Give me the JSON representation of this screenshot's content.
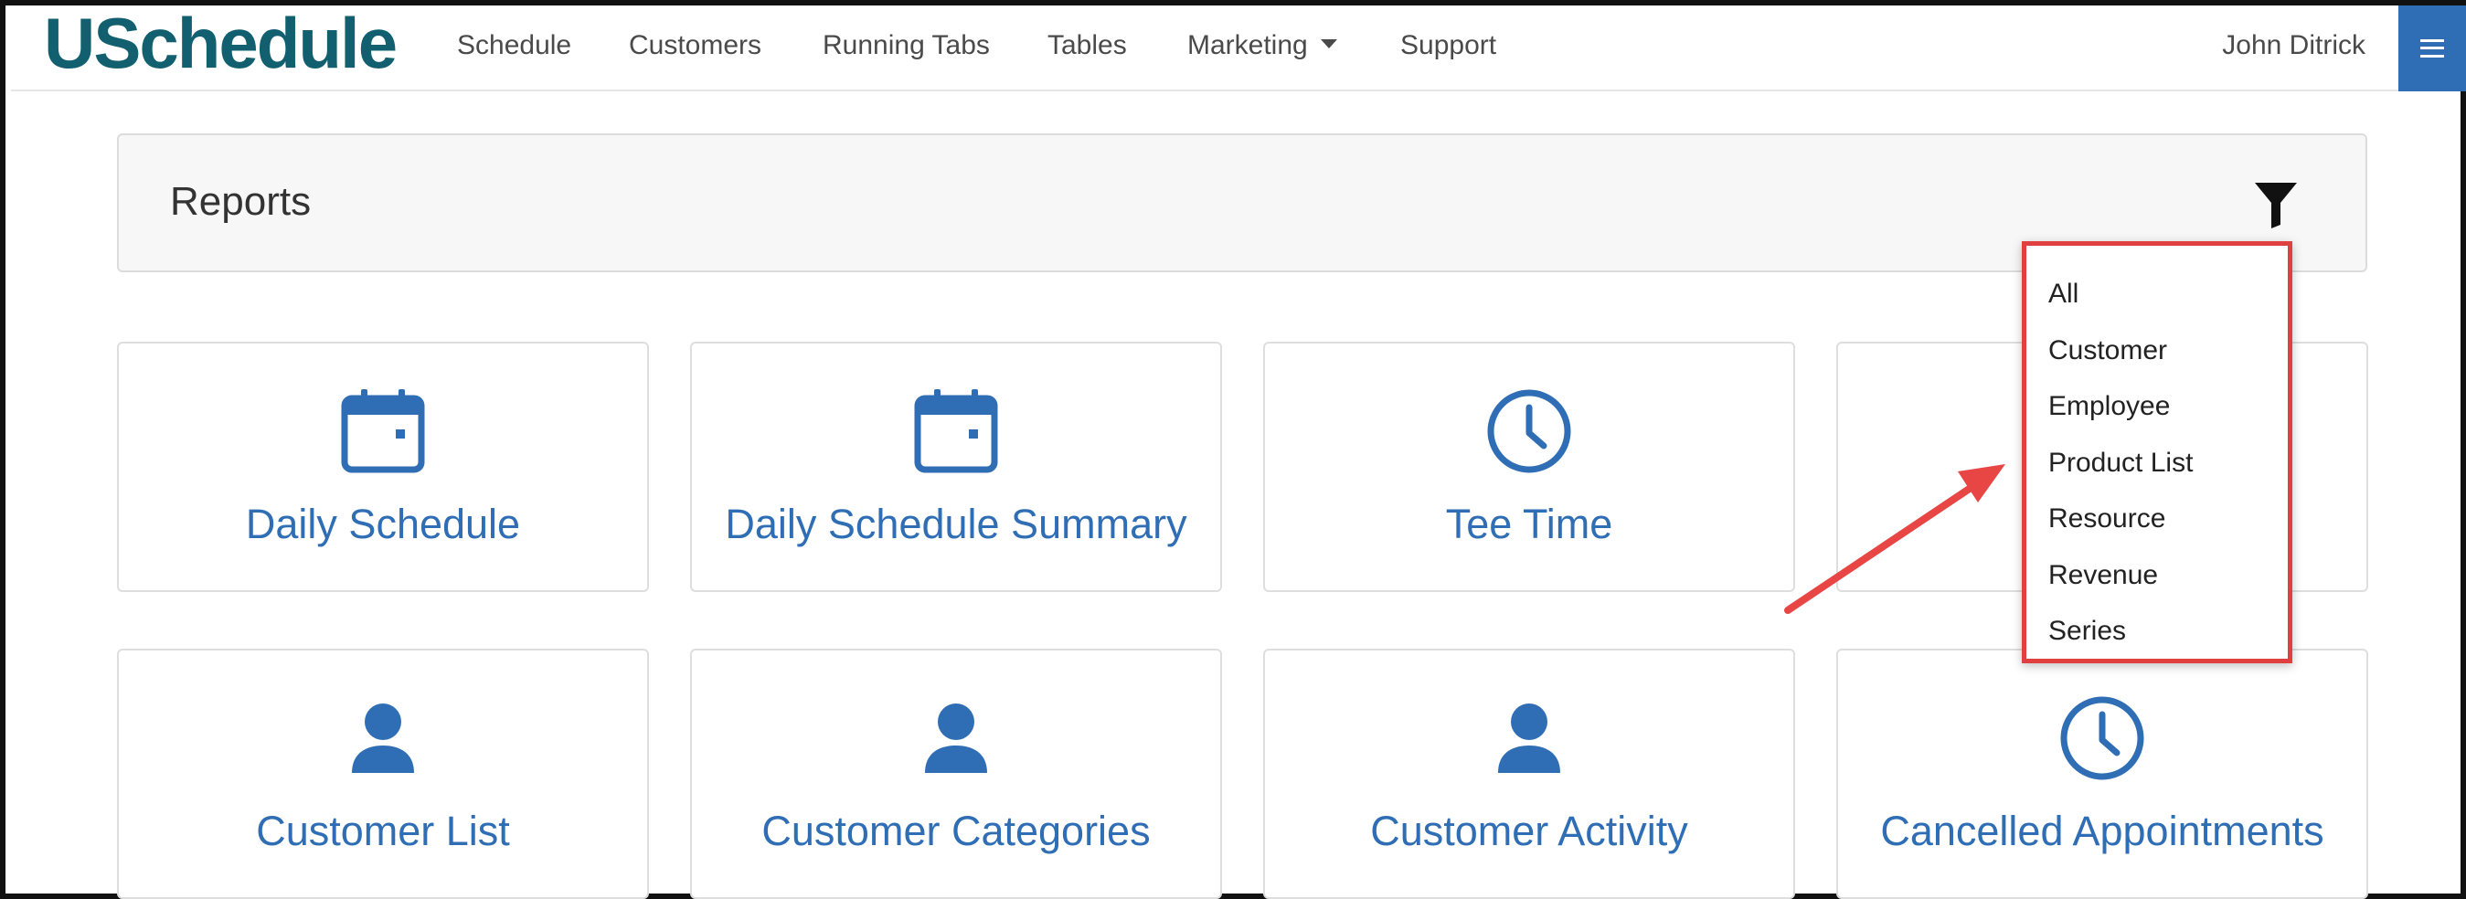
{
  "app": {
    "brand": "USchedule"
  },
  "nav": {
    "items": [
      {
        "label": "Schedule"
      },
      {
        "label": "Customers"
      },
      {
        "label": "Running Tabs"
      },
      {
        "label": "Tables"
      },
      {
        "label": "Marketing"
      },
      {
        "label": "Support"
      }
    ],
    "user": "John Ditrick"
  },
  "reports": {
    "title": "Reports"
  },
  "filter_dropdown": {
    "options": [
      "All",
      "Customer",
      "Employee",
      "Product List",
      "Resource",
      "Revenue",
      "Series"
    ]
  },
  "tiles": [
    {
      "label": "Daily Schedule",
      "icon": "calendar-icon"
    },
    {
      "label": "Daily Schedule Summary",
      "icon": "calendar-icon"
    },
    {
      "label": "Tee Time",
      "icon": "clock-icon"
    },
    {
      "label": "",
      "icon": "none"
    },
    {
      "label": "Customer List",
      "icon": "user-icon"
    },
    {
      "label": "Customer Categories",
      "icon": "user-icon"
    },
    {
      "label": "Customer Activity",
      "icon": "user-icon"
    },
    {
      "label": "Cancelled Appointments",
      "icon": "clock-icon"
    }
  ],
  "colors": {
    "brand": "#12606f",
    "accent": "#2f6eb4",
    "highlight": "#e04040"
  }
}
